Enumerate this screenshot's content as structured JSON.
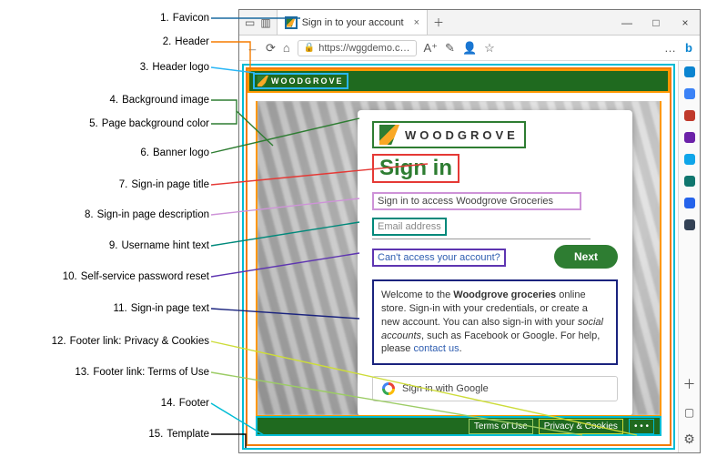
{
  "annotations": [
    "Favicon",
    "Header",
    "Header logo",
    "Background image",
    "Page background color",
    "Banner logo",
    "Sign-in page title",
    "Sign-in page description",
    "Username hint text",
    "Self-service password reset",
    "Sign-in page text",
    "Footer link: Privacy & Cookies",
    "Footer link: Terms of Use",
    "Footer",
    "Template"
  ],
  "browser": {
    "tab_title": "Sign in to your account",
    "url": "https://wggdemo.c…",
    "logo_text": "WOODGROVE"
  },
  "signin": {
    "banner_text": "WOODGROVE",
    "title": "Sign in",
    "description": "Sign in to access Woodgrove Groceries",
    "email_placeholder": "Email address",
    "sspr": "Can't access your account?",
    "next": "Next",
    "page_text_prefix": "Welcome to the ",
    "page_text_bold1": "Woodgrove groceries",
    "page_text_mid": " online store. Sign-in with your credentials, or create a new account. You can also sign-in with your ",
    "page_text_italic": "social accounts",
    "page_text_suffix": ", such as Facebook or Google. For help, please ",
    "contact": "contact us",
    "idp_google": "Sign in with Google"
  },
  "footer": {
    "terms": "Terms of Use",
    "privacy": "Privacy & Cookies",
    "more": "• • •"
  }
}
